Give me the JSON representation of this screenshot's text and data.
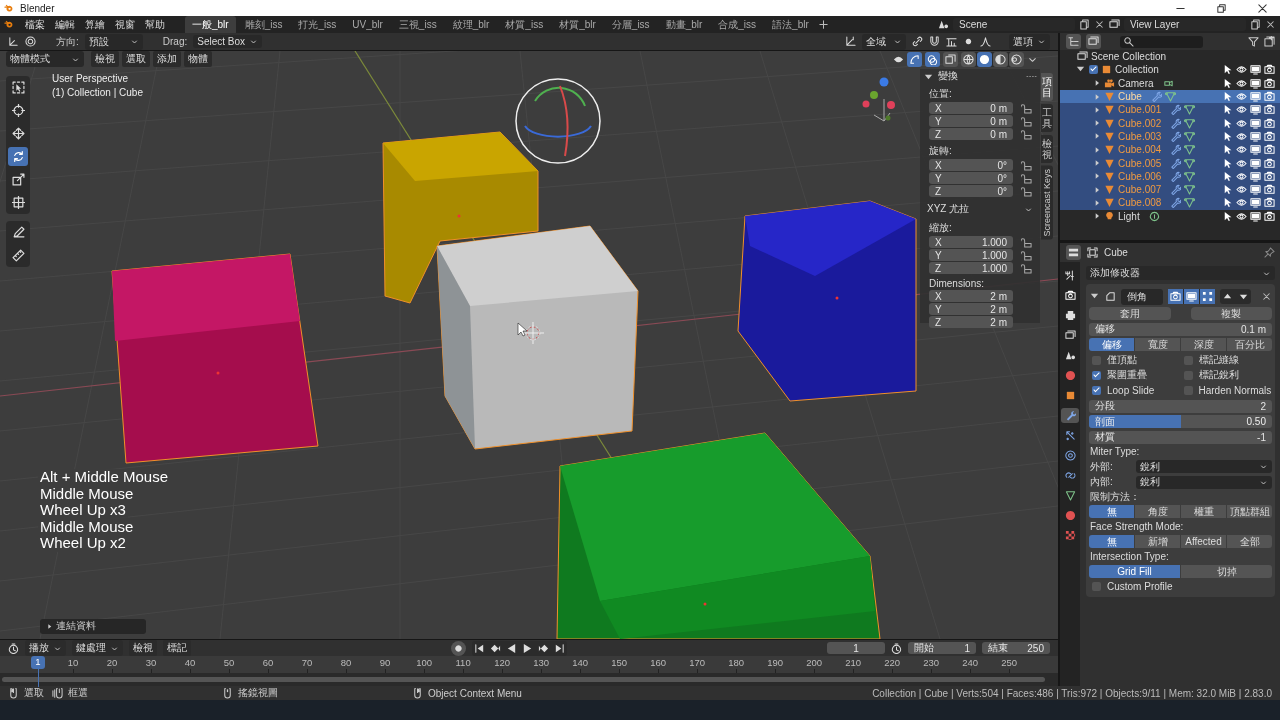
{
  "window": {
    "title": "Blender"
  },
  "menu": [
    "檔案",
    "編輯",
    "算繪",
    "視窗",
    "幫助"
  ],
  "workspaces": [
    {
      "label": "一般_blr",
      "selected": true
    },
    {
      "label": "雕刻_iss",
      "selected": false
    },
    {
      "label": "打光_iss",
      "selected": false
    },
    {
      "label": "UV_blr",
      "selected": false
    },
    {
      "label": "三視_iss",
      "selected": false
    },
    {
      "label": "紋理_blr",
      "selected": false
    },
    {
      "label": "材質_iss",
      "selected": false
    },
    {
      "label": "材質_blr",
      "selected": false
    },
    {
      "label": "分層_iss",
      "selected": false
    },
    {
      "label": "動畫_blr",
      "selected": false
    },
    {
      "label": "合成_iss",
      "selected": false
    },
    {
      "label": "語法_blr",
      "selected": false
    }
  ],
  "scene": "Scene",
  "view_layer": "View Layer",
  "tool_header": {
    "orientation_label": "方向:",
    "orientation": "預設",
    "drag_label": "Drag:",
    "drag": "Select Box",
    "pivot": "全域",
    "options": "選項"
  },
  "viewport_header": {
    "mode": "物體模式",
    "menus": [
      "檢視",
      "選取",
      "添加",
      "物體"
    ],
    "toggles": [
      {
        "kind": "gizmo",
        "on": true
      },
      {
        "kind": "overlay",
        "on": true
      },
      {
        "kind": "xray",
        "on": false
      }
    ],
    "shading": [
      {
        "kind": "wireframe",
        "selected": false
      },
      {
        "kind": "solid",
        "selected": true
      },
      {
        "kind": "material",
        "selected": false
      },
      {
        "kind": "rendered",
        "selected": false
      }
    ]
  },
  "tools": [
    {
      "kind": "select",
      "selected": false
    },
    {
      "kind": "cursor",
      "selected": false
    },
    {
      "kind": "move",
      "selected": false
    },
    {
      "kind": "rotate",
      "selected": true
    },
    {
      "kind": "scale",
      "selected": false
    },
    {
      "kind": "transform",
      "selected": false
    },
    {
      "kind": "annotate",
      "selected": false
    },
    {
      "kind": "measure",
      "selected": false
    }
  ],
  "viewport": {
    "view_name": "User Perspective",
    "context": "(1) Collection | Cube",
    "keys": [
      "Alt + Middle Mouse",
      "Middle Mouse",
      "Wheel Up x3",
      "Middle Mouse",
      "Wheel Up x2"
    ],
    "last_operation": "連結資料"
  },
  "sidebar": {
    "title": "變換",
    "groups": [
      {
        "label": "位置:",
        "fields": [
          {
            "axis": "X",
            "value": "0 m"
          },
          {
            "axis": "Y",
            "value": "0 m"
          },
          {
            "axis": "Z",
            "value": "0 m"
          }
        ],
        "locks": true
      },
      {
        "label": "旋轉:",
        "fields": [
          {
            "axis": "X",
            "value": "0°"
          },
          {
            "axis": "Y",
            "value": "0°"
          },
          {
            "axis": "Z",
            "value": "0°"
          }
        ],
        "locks": true,
        "mode": "XYZ 尤拉"
      },
      {
        "label": "縮放:",
        "fields": [
          {
            "axis": "X",
            "value": "1.000"
          },
          {
            "axis": "Y",
            "value": "1.000"
          },
          {
            "axis": "Z",
            "value": "1.000"
          }
        ],
        "locks": true
      },
      {
        "label": "Dimensions:",
        "fields": [
          {
            "axis": "X",
            "value": "2 m"
          },
          {
            "axis": "Y",
            "value": "2 m"
          },
          {
            "axis": "Z",
            "value": "2 m"
          }
        ],
        "locks": false
      }
    ],
    "tabs": [
      {
        "label": "項目",
        "selected": true
      },
      {
        "label": "工具",
        "selected": false
      },
      {
        "label": "檢視",
        "selected": false
      },
      {
        "label": "Screencast Keys",
        "selected": false
      }
    ]
  },
  "outliner": {
    "root": "Scene Collection",
    "collections": [
      {
        "name": "Collection",
        "checked": true,
        "expanded": true,
        "children": [
          {
            "name": "Camera",
            "kind": "camera",
            "selected": false,
            "active": false,
            "expanded": false
          },
          {
            "name": "Cube",
            "kind": "mesh",
            "selected": true,
            "active": true,
            "expanded": false
          },
          {
            "name": "Cube.001",
            "kind": "mesh",
            "selected": true,
            "active": false,
            "expanded": false
          },
          {
            "name": "Cube.002",
            "kind": "mesh",
            "selected": true,
            "active": false,
            "expanded": false
          },
          {
            "name": "Cube.003",
            "kind": "mesh",
            "selected": true,
            "active": false,
            "expanded": false
          },
          {
            "name": "Cube.004",
            "kind": "mesh",
            "selected": true,
            "active": false,
            "expanded": false
          },
          {
            "name": "Cube.005",
            "kind": "mesh",
            "selected": true,
            "active": false,
            "expanded": false
          },
          {
            "name": "Cube.006",
            "kind": "mesh",
            "selected": true,
            "active": false,
            "expanded": false
          },
          {
            "name": "Cube.007",
            "kind": "mesh",
            "selected": true,
            "active": false,
            "expanded": false
          },
          {
            "name": "Cube.008",
            "kind": "mesh",
            "selected": true,
            "active": false,
            "expanded": false
          },
          {
            "name": "Light",
            "kind": "light",
            "selected": false,
            "active": false,
            "expanded": false
          }
        ]
      }
    ]
  },
  "properties": {
    "object_name": "Cube",
    "tabs": [
      {
        "kind": "tool",
        "selected": false
      },
      {
        "kind": "render",
        "selected": false
      },
      {
        "kind": "output",
        "selected": false
      },
      {
        "kind": "view-layer",
        "selected": false
      },
      {
        "kind": "scene",
        "selected": false
      },
      {
        "kind": "world",
        "selected": false
      },
      {
        "kind": "object",
        "selected": false
      },
      {
        "kind": "modifier",
        "selected": true
      },
      {
        "kind": "particles",
        "selected": false
      },
      {
        "kind": "physics",
        "selected": false
      },
      {
        "kind": "constraints",
        "selected": false
      },
      {
        "kind": "data",
        "selected": false
      },
      {
        "kind": "material",
        "selected": false
      },
      {
        "kind": "texture",
        "selected": false
      }
    ],
    "add_modifier": "添加修改器",
    "modifier": {
      "name": "倒角",
      "expanded": true,
      "toggles": [
        {
          "kind": "editmode",
          "on": true
        },
        {
          "kind": "viewport",
          "on": true
        },
        {
          "kind": "render",
          "on": true
        }
      ],
      "apply": "套用",
      "copy": "複製",
      "amount": {
        "label": "偏移",
        "value": "0.1 m"
      },
      "width_type": [
        {
          "label": "偏移",
          "selected": true
        },
        {
          "label": "寬度",
          "selected": false
        },
        {
          "label": "深度",
          "selected": false
        },
        {
          "label": "百分比",
          "selected": false
        }
      ],
      "checks": [
        {
          "label": "僅頂點",
          "checked": false
        },
        {
          "label": "標記縫線",
          "checked": false
        },
        {
          "label": "聚圍重疊",
          "checked": true
        },
        {
          "label": "標記銳利",
          "checked": false
        },
        {
          "label": "Loop Slide",
          "checked": true
        },
        {
          "label": "Harden Normals",
          "checked": false
        }
      ],
      "segments": {
        "label": "分段",
        "value": "2"
      },
      "profile": {
        "label": "剖面",
        "value": "0.50",
        "level": 0.5
      },
      "material": {
        "label": "材質",
        "value": "-1"
      },
      "miter_label": "Miter Type:",
      "miters": [
        {
          "label": "外部:",
          "value": "銳利"
        },
        {
          "label": "內部:",
          "value": "銳利"
        }
      ],
      "limit_label": "限制方法：",
      "limit": [
        {
          "label": "無",
          "selected": true
        },
        {
          "label": "角度",
          "selected": false
        },
        {
          "label": "權重",
          "selected": false
        },
        {
          "label": "頂點群組",
          "selected": false
        }
      ],
      "face_strength_label": "Face Strength Mode:",
      "face_strength": [
        {
          "label": "無",
          "selected": true
        },
        {
          "label": "新增",
          "selected": false
        },
        {
          "label": "Affected",
          "selected": false
        },
        {
          "label": "全部",
          "selected": false
        }
      ],
      "intersection_label": "Intersection Type:",
      "intersection": [
        {
          "label": "Grid Fill",
          "selected": true
        },
        {
          "label": "切掉",
          "selected": false
        }
      ],
      "custom_profile": {
        "label": "Custom Profile",
        "checked": false
      }
    }
  },
  "timeline": {
    "menus": [
      "播放",
      "鍵處理",
      "檢視",
      "標記"
    ],
    "frame": "1",
    "start_label": "開始",
    "start": "1",
    "end_label": "結束",
    "end": "250",
    "playhead": "1",
    "ticks": [
      "10",
      "20",
      "30",
      "40",
      "50",
      "60",
      "70",
      "80",
      "90",
      "100",
      "110",
      "120",
      "130",
      "140",
      "150",
      "160",
      "170",
      "180",
      "190",
      "200",
      "210",
      "220",
      "230",
      "240",
      "250"
    ]
  },
  "status_bar": {
    "hints": [
      {
        "kind": "left",
        "label": "選取"
      },
      {
        "kind": "drag",
        "label": "框選"
      },
      {
        "kind": "middle",
        "label": "搖鏡視圖"
      },
      {
        "kind": "right",
        "label": "Object Context Menu"
      }
    ],
    "stats": "Collection | Cube | Verts:504 | Faces:486 | Tris:972 | Objects:9/11 | Mem: 32.0 MiB | 2.83.0"
  }
}
